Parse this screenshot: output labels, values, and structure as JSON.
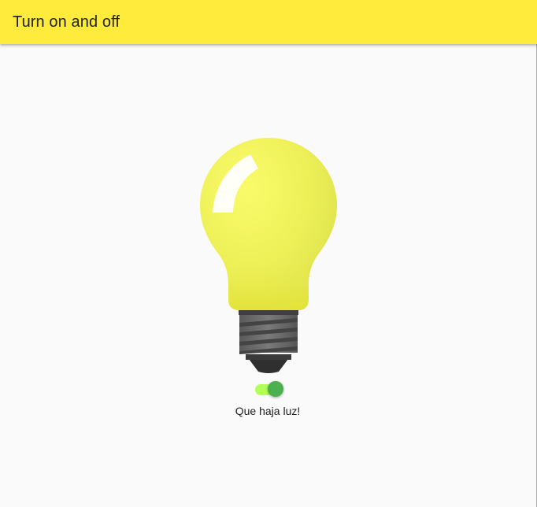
{
  "appbar": {
    "title": "Turn on and off",
    "color": "#ffeb3b"
  },
  "bulb": {
    "icon": "lightbulb-icon",
    "state": "on",
    "glass_color": "#f0f04a"
  },
  "switch": {
    "checked": true,
    "thumb_color": "#4caf50",
    "track_color": "#b2ff59"
  },
  "caption": "Que haja luz!"
}
